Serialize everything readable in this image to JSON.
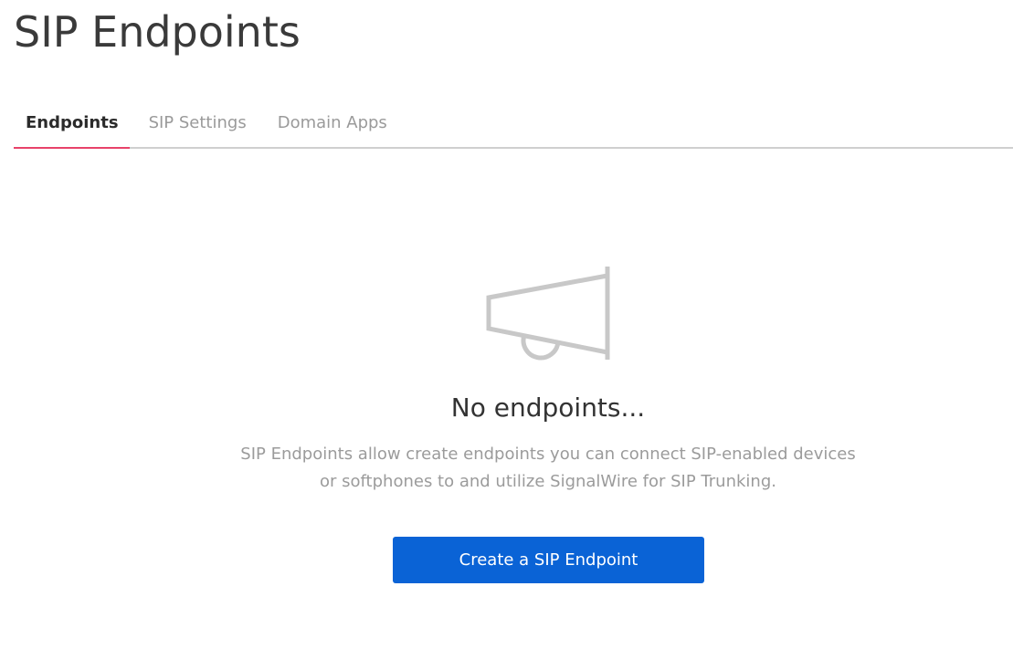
{
  "page": {
    "title": "SIP Endpoints"
  },
  "tabs": [
    {
      "label": "Endpoints",
      "active": true
    },
    {
      "label": "SIP Settings",
      "active": false
    },
    {
      "label": "Domain Apps",
      "active": false
    }
  ],
  "empty_state": {
    "icon": "megaphone-icon",
    "title": "No endpoints...",
    "description_line1": "SIP Endpoints allow create endpoints you can connect SIP-enabled devices",
    "description_line2": "or softphones to and utilize SignalWire for SIP Trunking.",
    "button_label": "Create a SIP Endpoint"
  },
  "colors": {
    "accent_tab": "#e8436a",
    "primary_button": "#0a63d6",
    "icon_gray": "#c8c8c8"
  }
}
